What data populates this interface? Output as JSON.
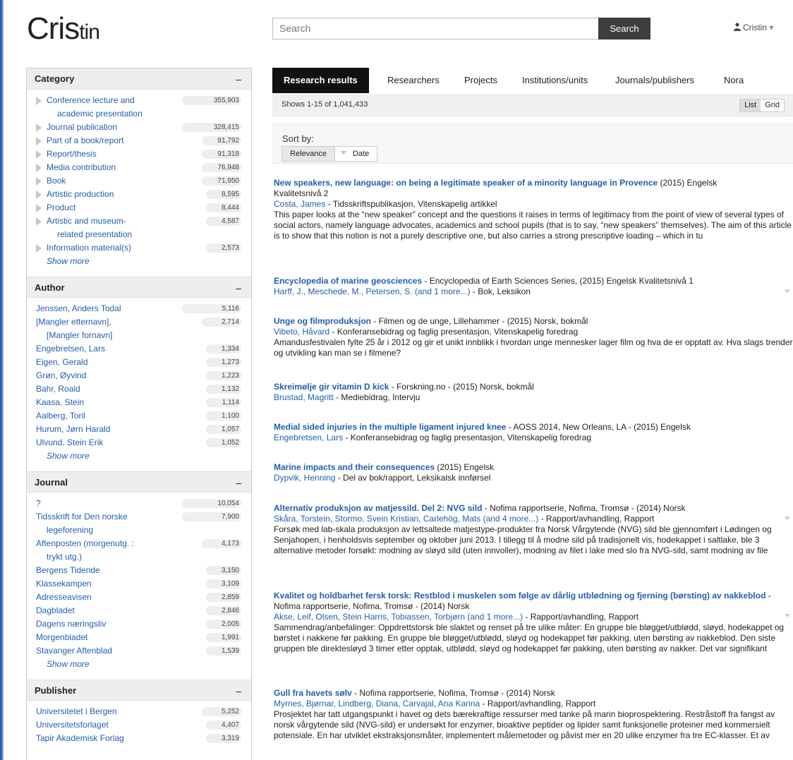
{
  "header": {
    "logo_main": "Cris",
    "logo_sub": "tin",
    "search_placeholder": "Search",
    "search_button": "Search",
    "user_label": "Cristin"
  },
  "sidebar": {
    "category": {
      "title": "Category",
      "collapse": "–",
      "items": [
        {
          "line1": "Conference lecture and",
          "line2": "academic presentation",
          "count": "355,903"
        },
        {
          "line1": "Journal publication",
          "count": "328,415"
        },
        {
          "line1": "Part of a book/report",
          "count": "91,792"
        },
        {
          "line1": "Report/thesis",
          "count": "91,318"
        },
        {
          "line1": "Media contribution",
          "count": "76,948"
        },
        {
          "line1": "Book",
          "count": "71,950"
        },
        {
          "line1": "Artistic production",
          "count": "8,595"
        },
        {
          "line1": "Product",
          "count": "8,444"
        },
        {
          "line1": "Artistic and museum-",
          "line2": "related presentation",
          "count": "4,587"
        },
        {
          "line1": "Information material(s)",
          "count": "2,573"
        }
      ],
      "show_more": "Show more"
    },
    "author": {
      "title": "Author",
      "collapse": "–",
      "items": [
        {
          "line1": "Jenssen, Anders Todal",
          "count": "5,116"
        },
        {
          "line1": "[Mangler etternavn],",
          "line2": "[Mangler fornavn]",
          "count": "2,714"
        },
        {
          "line1": "Engebretsen, Lars",
          "count": "1,334"
        },
        {
          "line1": "Eigen, Gerald",
          "count": "1,273"
        },
        {
          "line1": "Grøn, Øyvind",
          "count": "1,223"
        },
        {
          "line1": "Bahr, Roald",
          "count": "1,132"
        },
        {
          "line1": "Kaasa, Stein",
          "count": "1,114"
        },
        {
          "line1": "Aalberg, Toril",
          "count": "1,100"
        },
        {
          "line1": "Hurum, Jørn Harald",
          "count": "1,057"
        },
        {
          "line1": "Ulvund, Stein Erik",
          "count": "1,052"
        }
      ],
      "show_more": "Show more"
    },
    "journal": {
      "title": "Journal",
      "collapse": "–",
      "items": [
        {
          "line1": "?",
          "count": "10,054"
        },
        {
          "line1": "Tidsskrift for Den norske",
          "line2": "legeforening",
          "count": "7,900"
        },
        {
          "line1": "Aftenposten (morgenutg. :",
          "line2": "trykt utg.)",
          "count": "4,173"
        },
        {
          "line1": "Bergens Tidende",
          "count": "3,150"
        },
        {
          "line1": "Klassekampen",
          "count": "3,109"
        },
        {
          "line1": "Adresseavisen",
          "count": "2,859"
        },
        {
          "line1": "Dagbladet",
          "count": "2,846"
        },
        {
          "line1": "Dagens næringsliv",
          "count": "2,005"
        },
        {
          "line1": "Morgenbladet",
          "count": "1,991"
        },
        {
          "line1": "Stavanger Aftenblad",
          "count": "1,539"
        }
      ],
      "show_more": "Show more"
    },
    "publisher": {
      "title": "Publisher",
      "collapse": "–",
      "items": [
        {
          "line1": "Universitetet i Bergen",
          "count": "5,252"
        },
        {
          "line1": "Universitetsforlaget",
          "count": "4,407"
        },
        {
          "line1": "Tapir Akademisk Forlag",
          "count": "3,319"
        }
      ]
    }
  },
  "tabs": [
    "Research results",
    "Researchers",
    "Projects",
    "Institutions/units",
    "Journals/publishers",
    "Nora"
  ],
  "results_bar": {
    "shows": "Shows 1-15 of 1,041,433",
    "view_list": "List",
    "view_grid": "Grid"
  },
  "sort": {
    "label": "Sort by:",
    "relevance": "Relevance",
    "date": "Date"
  },
  "results": [
    {
      "title": "New speakers, new language: on being a legitimate speaker of a minority language in Provence",
      "title_suffix": " (2015) Engelsk",
      "line2": "Kvalitetsnivå 2",
      "authors": "Costa, James",
      "type": " - Tidsskriftspublikasjon, Vitenskapelig artikkel",
      "abstract": "This paper looks at the “new speaker” concept and the questions it raises in terms of legitimacy from the point of view of several types of social actors, namely language advocates, academics and school pupils (that is to say, “new speakers” themselves). The aim of this article is to show that this notion is not a purely descriptive one, but also carries a strong prescriptive loading – which in tu"
    },
    {
      "title": "Encyclopedia of marine geosciences",
      "title_suffix": " - Encyclopedia of Earth Sciences Series, (2015) Engelsk Kvalitetsnivå 1",
      "authors": "Harff, J., Meschede, M., Petersen, S. (and 1 more...)",
      "type": " - Bok, Leksikon"
    },
    {
      "title": "Unge og filmproduksjon",
      "title_suffix": " - Filmen og de unge, Lillehammer - (2015) Norsk, bokmål",
      "authors": "Vibeto, Håvard",
      "type": " - Konferansebidrag og faglig presentasjon, Vitenskapelig foredrag",
      "abstract": "Amandusfestivalen fylte 25 år i 2012 og gir et unikt innblikk i hvordan unge mennesker lager film og hva de er opptatt av. Hva slags trender og utvikling kan man se i filmene?"
    },
    {
      "title": "Skreimølje gir vitamin D kick",
      "title_suffix": " - Forskning.no - (2015) Norsk, bokmål",
      "authors": "Brustad, Magritt",
      "type": " - Mediebidrag, Intervju"
    },
    {
      "title": "Medial sided injuries in the multiple ligament injured knee",
      "title_suffix": " - AOSS 2014, New Orleans, LA - (2015) Engelsk",
      "authors": "Engebretsen, Lars",
      "type": " - Konferansebidrag og faglig presentasjon, Vitenskapelig foredrag"
    },
    {
      "title": "Marine impacts and their consequences",
      "title_suffix": " (2015) Engelsk",
      "authors": "Dypvik, Henning",
      "type": " - Del av bok/rapport, Leksikalsk innførsel"
    },
    {
      "title": "Alternativ produksjon av matjessild. Del 2: NVG sild",
      "title_suffix": " - Nofima rapportserie, Nofima, Tromsø - (2014) Norsk",
      "authors": "Skåra, Torstein, Stormo, Svein Kristian, Carlehög, Mats (and 4 more...)",
      "type": " - Rapport/avhandling, Rapport",
      "abstract": "Forsøk med lab-skala produksjon av lettsaltede matjestype-produkter fra Norsk Vårgytende (NVG) sild ble gjennomført i Lødingen og Senjahopen, i henholdsvis september og oktober juni 2013. I tillegg til å modne sild på tradisjonelt vis, hodekappet i saltlake, ble 3 alternative metoder forsøkt: modning av sløyd sild (uten innvoller), modning av filet i lake med slo fra NVG-sild, samt modning av file"
    },
    {
      "title": "Kvalitet og holdbarhet fersk torsk: Restblod i muskelen som følge av dårlig utblødning og fjerning (børsting) av nakkeblod",
      "title_suffix": " - Nofima rapportserie, Nofima, Tromsø - (2014) Norsk",
      "authors": "Akse, Leif, Olsen, Stein Harris, Tobiassen, Torbjørn (and 1 more...)",
      "type": " - Rapport/avhandling, Rapport",
      "abstract": "Sammendrag/anbefalinger: Oppdrettstorsk ble slaktet og renset på tre ulike måter: En gruppe ble bløgget/utblødd, sløyd, hodekappet og børstet i nakkene før pakking. En gruppe ble bløgget/utblødd, sløyd og hodekappet før pakking, uten børsting av nakkeblod. Den siste gruppen ble direktesløyd 3 timer etter opptak, utblødd, sløyd og hodekappet før pakking, uten børsting av nakker. Det var signifikant"
    },
    {
      "title": "Gull fra havets sølv",
      "title_suffix": " - Nofima rapportserie, Nofima, Tromsø - (2014) Norsk",
      "authors": "Myrnes, Bjørnar, Lindberg, Diana, Carvajal, Ana Karina",
      "type": " - Rapport/avhandling, Rapport",
      "abstract": "Prosjektet har tatt utgangspunkt i havet og dets bærekraftige ressurser med tanke på marin bioprospektering. Restråstoff fra fangst av norsk vårgytende sild (NVG-sild) er undersøkt for enzymer, bioaktive peptider og lipider samt funksjonelle proteiner med kommersielt potensiale. En har utviklet ekstraksjonsmåter, implementert målemetoder og påvist mer en 20 ulike enzymer fra tre EC-klasser. Et av"
    }
  ]
}
